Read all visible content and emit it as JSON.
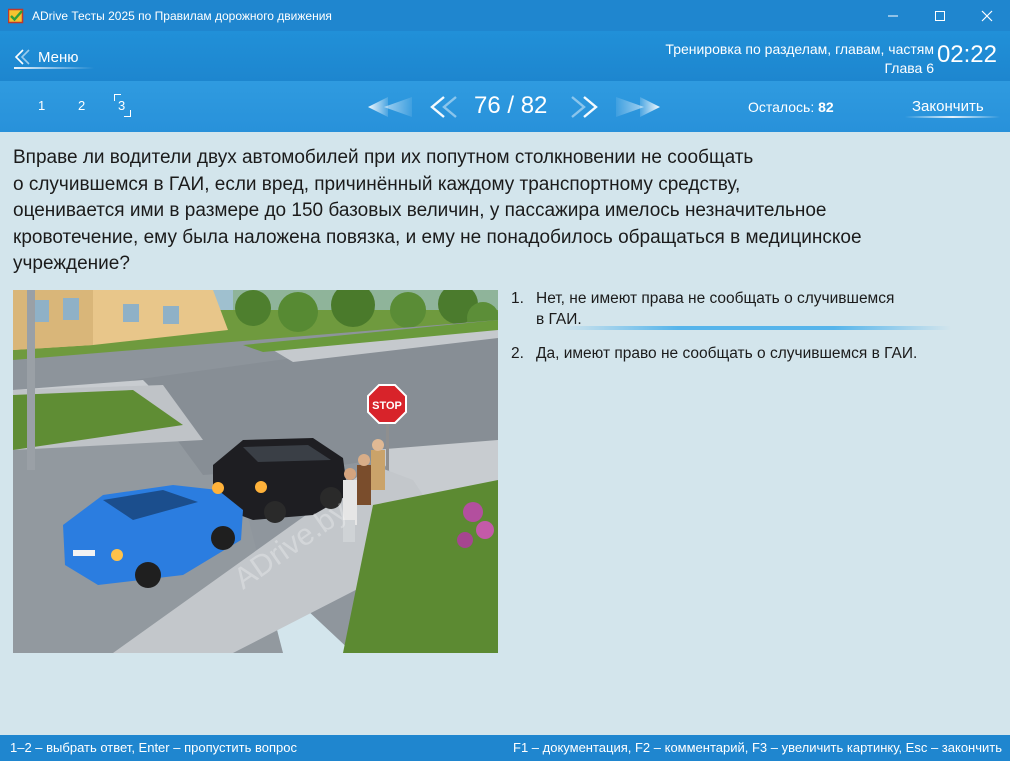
{
  "window": {
    "title": "ADrive Тесты 2025 по Правилам дорожного движения",
    "icon": "checkmark-app-icon"
  },
  "header": {
    "menu_label": "Меню",
    "mode_line1": "Тренировка по разделам, главам, частям",
    "mode_line2": "Глава 6",
    "timer": "02:22"
  },
  "nav": {
    "parts": [
      "1",
      "2",
      "3"
    ],
    "active_part": "3",
    "current": 76,
    "total": 82,
    "counter_text": "76 / 82",
    "remaining_label": "Осталось:",
    "remaining_value": "82",
    "finish_label": "Закончить"
  },
  "question": {
    "line1": "Вправе ли водители двух автомобилей при их попутном столкновении не сообщать",
    "line2": "о случившемся в ГАИ, если вред, причинённый каждому транспортному средству,",
    "line3": "оценивается ими в размере до 150 базовых величин, у пассажира имелось незначительное",
    "line4": "кровотечение, ему была наложена повязка, и ему не понадобилось обращаться в медицинское",
    "line5": "учреждение?"
  },
  "picture": {
    "sign_text": "STOP",
    "watermark": "ADrive.by"
  },
  "answers": [
    {
      "number": "1.",
      "line1": "Нет, не имеют права не сообщать о случившемся",
      "line2": "в ГАИ."
    },
    {
      "number": "2.",
      "line1": "Да, имеют право не сообщать о случившемся в ГАИ.",
      "line2": ""
    }
  ],
  "status": {
    "left": "1–2 – выбрать ответ, Enter – пропустить вопрос",
    "right": "F1 – документация, F2 – комментарий, F3 – увеличить картинку, Esc – закончить"
  },
  "colors": {
    "titlebar": "#1f86cf",
    "navbar": "#2891da",
    "content_bg": "#d3e5ec",
    "accent_glow": "#4fb2eb"
  }
}
